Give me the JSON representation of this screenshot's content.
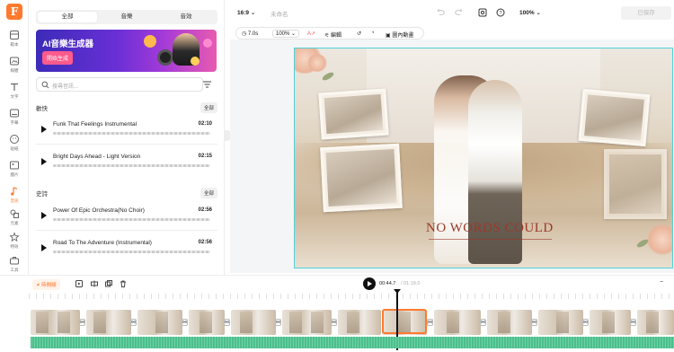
{
  "app": {
    "logo_letter": "F",
    "accent": "#ff7a2f"
  },
  "rail": {
    "items": [
      {
        "label": "範本",
        "icon": "template-icon"
      },
      {
        "label": "媒體",
        "icon": "media-icon"
      },
      {
        "label": "文字",
        "icon": "text-icon"
      },
      {
        "label": "字幕",
        "icon": "subtitle-icon"
      },
      {
        "label": "貼紙",
        "icon": "sticker-icon"
      },
      {
        "label": "圖片",
        "icon": "image-icon"
      },
      {
        "label": "音訊",
        "icon": "music-icon"
      },
      {
        "label": "元素",
        "icon": "elements-icon"
      },
      {
        "label": "特效",
        "icon": "effects-icon"
      },
      {
        "label": "工具",
        "icon": "tools-icon"
      }
    ]
  },
  "library": {
    "tabs": [
      {
        "label": "全部",
        "active": true
      },
      {
        "label": "音樂",
        "active": false
      },
      {
        "label": "音效",
        "active": false
      }
    ],
    "banner": {
      "title": "AI音樂生成器",
      "button": "開始生成"
    },
    "search": {
      "placeholder": "搜尋音訊..."
    },
    "sections": [
      {
        "title": "歡快",
        "all_label": "全部",
        "tracks": [
          {
            "name": "Funk That Feelings Instrumental",
            "duration": "02:10"
          },
          {
            "name": "Bright Days Ahead - Light Version",
            "duration": "02:15"
          }
        ]
      },
      {
        "title": "史詩",
        "all_label": "全部",
        "tracks": [
          {
            "name": "Power Of Epic Orchestra(No Choir)",
            "duration": "02:56"
          },
          {
            "name": "Road To The Adventure (Instrumental)",
            "duration": "02:56"
          }
        ]
      }
    ]
  },
  "topbar": {
    "ratio": "16:9",
    "project_name": "未命名",
    "zoom": "100%",
    "export_label": "已保存"
  },
  "edit_toolbar": {
    "duration": "7.0s",
    "zoom": "100%",
    "edit_label": "編輯",
    "animation_label": "圖內動畫"
  },
  "canvas": {
    "overlay_text": "NO WORDS COULD"
  },
  "timeline": {
    "button_label": "時間線",
    "current_time": "00:44.7",
    "total_time": "/ 01:19.0"
  }
}
